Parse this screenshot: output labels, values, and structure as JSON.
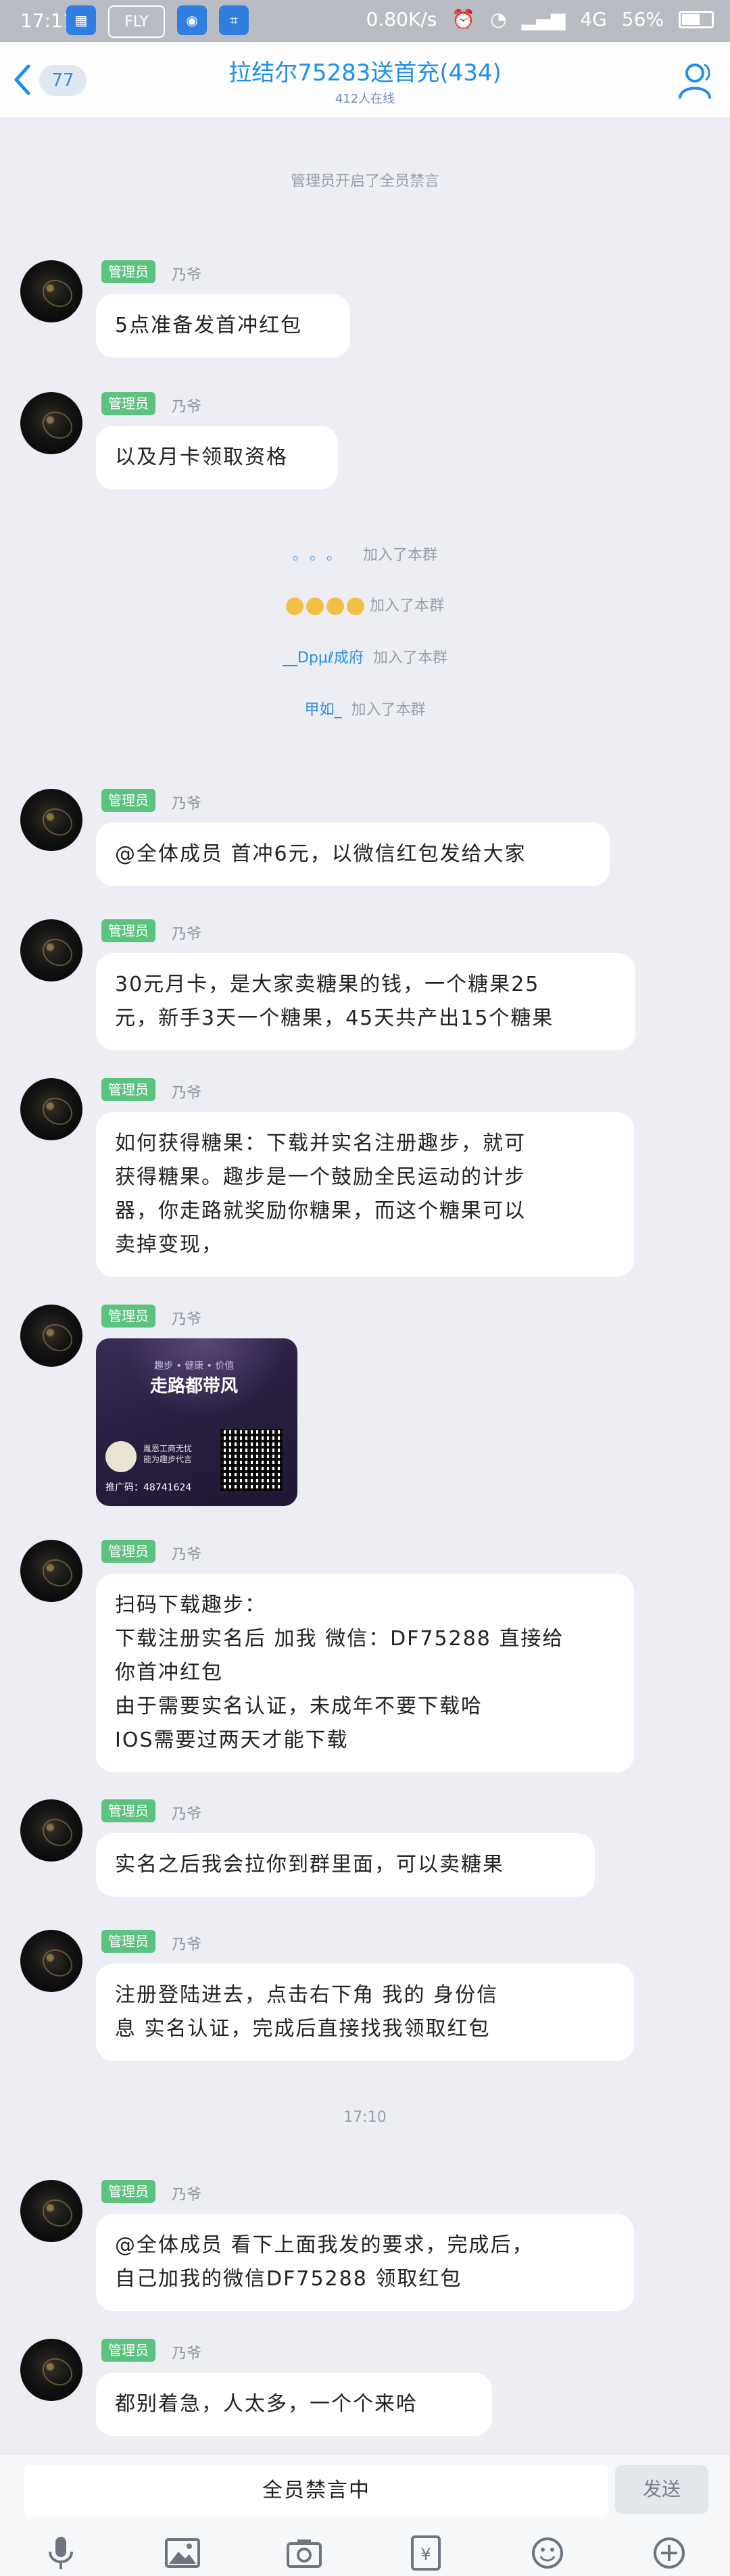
{
  "status_bar": {
    "time": "17:11",
    "apps": [
      "FLY"
    ],
    "network_speed": "0.80K/s",
    "signal": "4G",
    "battery": "56%",
    "battery_level": 0.56
  },
  "header": {
    "unread_count": "77",
    "title": "拉结尔75283送首充(434)",
    "online": "412人在线"
  },
  "system_messages": {
    "mute_notice": "管理员开启了全员禁言",
    "joined": "加入了本群",
    "member_dots": "。。。",
    "member_dpul": "__Dpμℓ成府",
    "member_jiaru": "甲如_",
    "time_divider": "17:10"
  },
  "messages": [
    {
      "role": "管理员",
      "sender": "乃爷",
      "lines": [
        "5点准备发首冲红包"
      ]
    },
    {
      "role": "管理员",
      "sender": "乃爷",
      "lines": [
        "以及月卡领取资格"
      ]
    },
    {
      "role": "管理员",
      "sender": "乃爷",
      "lines": [
        "@全体成员 首冲6元，以微信红包发给大家"
      ]
    },
    {
      "role": "管理员",
      "sender": "乃爷",
      "lines": [
        "30元月卡，是大家卖糖果的钱，一个糖果25",
        "元，新手3天一个糖果，45天共产出15个糖果"
      ]
    },
    {
      "role": "管理员",
      "sender": "乃爷",
      "lines": [
        "如何获得糖果：下载并实名注册趣步，就可",
        "获得糖果。趣步是一个鼓励全民运动的计步",
        "器，你走路就奖励你糖果，而这个糖果可以",
        "卖掉变现，"
      ]
    },
    {
      "role": "管理员",
      "sender": "乃爷",
      "image": {
        "tagline": "趣步 • 健康 • 价值",
        "slogan": "走路都带风",
        "brand": "胤恩工商无忧 能为趣步代言",
        "promo": "推广码：48741624"
      }
    },
    {
      "role": "管理员",
      "sender": "乃爷",
      "lines": [
        "扫码下载趣步：",
        "下载注册实名后 加我 微信：DF75288 直接给",
        "你首冲红包",
        "由于需要实名认证，未成年不要下载哈",
        "IOS需要过两天才能下载"
      ]
    },
    {
      "role": "管理员",
      "sender": "乃爷",
      "lines": [
        "实名之后我会拉你到群里面，可以卖糖果"
      ]
    },
    {
      "role": "管理员",
      "sender": "乃爷",
      "lines": [
        "注册登陆进去，点击右下角  我的  身份信",
        "息  实名认证，完成后直接找我领取红包"
      ]
    },
    {
      "role": "管理员",
      "sender": "乃爷",
      "lines": [
        "@全体成员 看下上面我发的要求，完成后，",
        "自己加我的微信DF75288 领取红包"
      ]
    },
    {
      "role": "管理员",
      "sender": "乃爷",
      "lines": [
        "都别着急，人太多，一个个来哈"
      ]
    }
  ],
  "input_bar": {
    "muted_text": "全员禁言中",
    "send_label": "发送",
    "tools": [
      "microphone-icon",
      "image-icon",
      "camera-icon",
      "red-packet-icon",
      "emoji-icon",
      "plus-icon"
    ]
  }
}
